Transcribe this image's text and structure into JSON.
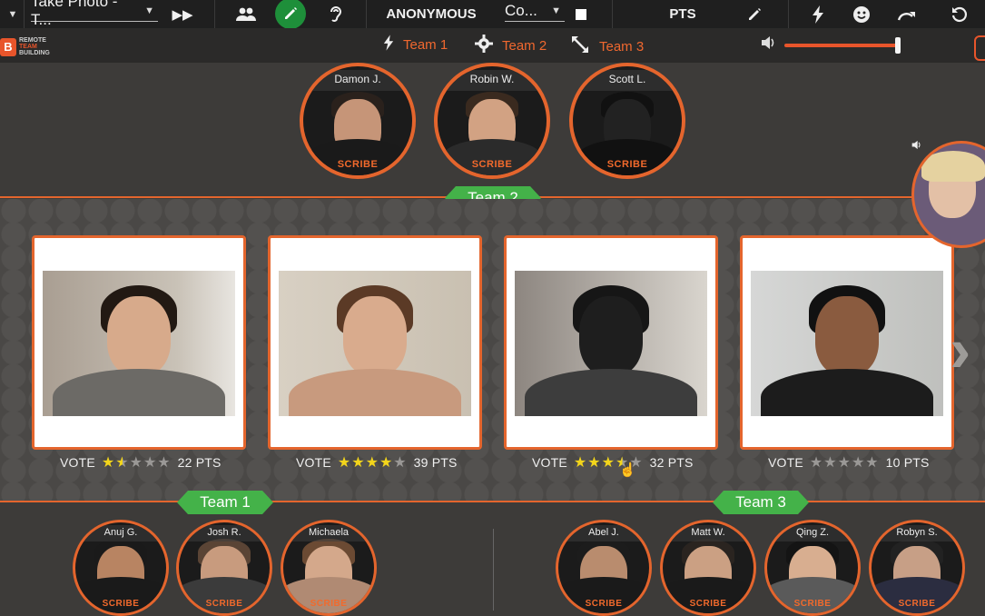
{
  "toolbar": {
    "activity_dropdown": "Take Photo - T...",
    "anonymous_label": "ANONYMOUS",
    "color_dropdown": "Co...",
    "pts_label": "PTS"
  },
  "header": {
    "logo_text_line1": "REMOTE",
    "logo_text_line2": "TEAM",
    "logo_text_line3": "BUILDING",
    "team_tabs": [
      {
        "label": "Team 1",
        "icon": "bolt-icon"
      },
      {
        "label": "Team 2",
        "icon": "gear-icon"
      },
      {
        "label": "Team 3",
        "icon": "expand-arrows-icon"
      }
    ],
    "volume_level": 0.98
  },
  "team2": {
    "label": "Team 2",
    "members": [
      {
        "name": "Damon J.",
        "role": "SCRIBE"
      },
      {
        "name": "Robin W.",
        "role": "SCRIBE"
      },
      {
        "name": "Scott L.",
        "role": "SCRIBE"
      }
    ]
  },
  "photos": [
    {
      "vote_label": "VOTE",
      "rating": 1.5,
      "points": "22 PTS"
    },
    {
      "vote_label": "VOTE",
      "rating": 4,
      "points": "39 PTS"
    },
    {
      "vote_label": "VOTE",
      "rating": 3.5,
      "points": "32 PTS"
    },
    {
      "vote_label": "VOTE",
      "rating": 0,
      "points": "10 PTS"
    }
  ],
  "team1": {
    "label": "Team 1",
    "members": [
      {
        "name": "Anuj G.",
        "role": "SCRIBE"
      },
      {
        "name": "Josh R.",
        "role": "SCRIBE"
      },
      {
        "name": "Michaela",
        "role": "SCRIBE"
      }
    ]
  },
  "team3": {
    "label": "Team 3",
    "members": [
      {
        "name": "Abel J.",
        "role": "SCRIBE"
      },
      {
        "name": "Matt W.",
        "role": "SCRIBE"
      },
      {
        "name": "Qing Z.",
        "role": "SCRIBE"
      },
      {
        "name": "Robyn S.",
        "role": "SCRIBE"
      }
    ]
  },
  "colors": {
    "accent_orange": "#e4652d",
    "team_green": "#44b249",
    "star_yellow": "#f3d51b"
  }
}
